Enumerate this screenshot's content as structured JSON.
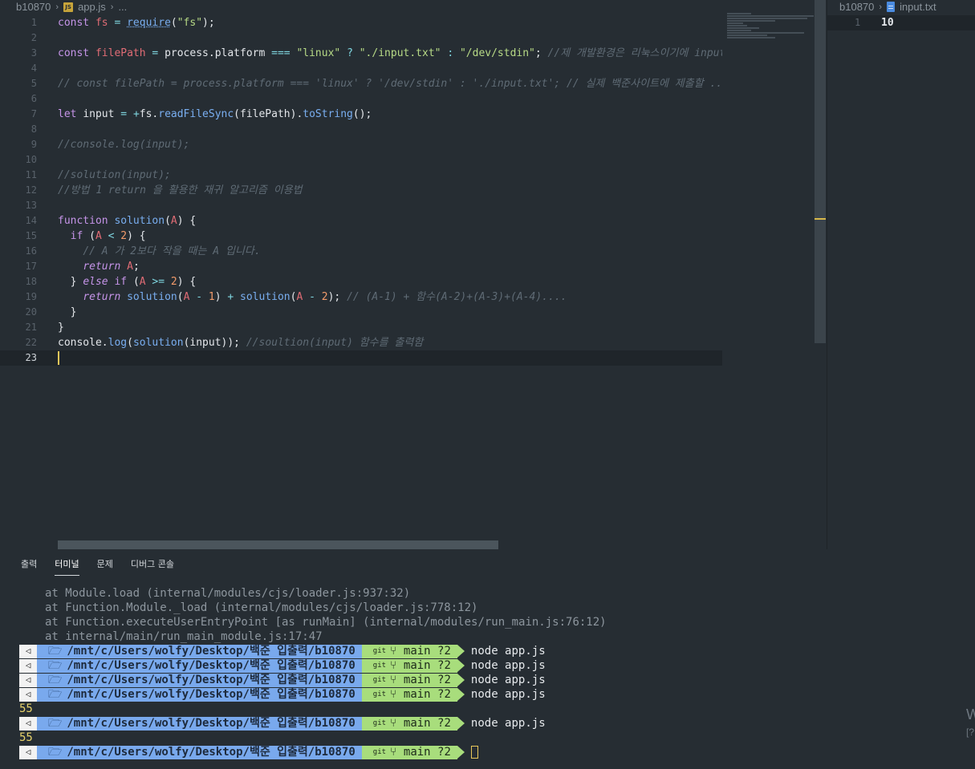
{
  "editor": {
    "breadcrumb": {
      "folder": "b10870",
      "file": "app.js",
      "more": "..."
    },
    "active_line": 23,
    "lines": [
      {
        "n": 1
      },
      {
        "n": 2
      },
      {
        "n": 3
      },
      {
        "n": 4
      },
      {
        "n": 5
      },
      {
        "n": 6
      },
      {
        "n": 7
      },
      {
        "n": 8
      },
      {
        "n": 9
      },
      {
        "n": 10
      },
      {
        "n": 11
      },
      {
        "n": 12
      },
      {
        "n": 13
      },
      {
        "n": 14
      },
      {
        "n": 15
      },
      {
        "n": 16
      },
      {
        "n": 17
      },
      {
        "n": 18
      },
      {
        "n": 19
      },
      {
        "n": 20
      },
      {
        "n": 21
      },
      {
        "n": 22
      },
      {
        "n": 23
      }
    ],
    "tokens": {
      "l1": [
        "const",
        "fs",
        "=",
        "require",
        "(",
        "\"fs\"",
        ");"
      ],
      "l3": [
        "const",
        "filePath",
        "=",
        "process.platform",
        "===",
        "\"linux\"",
        "?",
        "\"./input.txt\"",
        ":",
        "\"/dev/stdin\"",
        ";",
        "//제 개발환경은 리눅스이기에 input"
      ],
      "l5": "// const filePath = process.platform === 'linux' ? '/dev/stdin' : './input.txt'; // 실제 백준사이트에 제출할 ...",
      "l7": [
        "let",
        "input",
        "=",
        "+",
        "fs",
        ".",
        "readFileSync",
        "(filePath).",
        "toString",
        "();"
      ],
      "l9": "//console.log(input);",
      "l11": "//solution(input);",
      "l12": "//방법 1 return 을 활용한 재귀 알고리즘 이용법",
      "l14": [
        "function",
        "solution",
        "(",
        "A",
        ") {"
      ],
      "l15": [
        "if",
        "(",
        "A",
        "<",
        "2",
        ") {"
      ],
      "l16": "// A 가 2보다 작을 때는 A 입니다.",
      "l17": [
        "return",
        "A",
        ";"
      ],
      "l18": [
        "} ",
        "else",
        "if",
        "(",
        "A",
        ">=",
        "2",
        ") {"
      ],
      "l19": [
        "return",
        "solution",
        "(",
        "A",
        "-",
        "1",
        ")",
        "+",
        "solution",
        "(",
        "A",
        "-",
        "2",
        ");",
        "// (A-1) + 함수(A-2)+(A-3)+(A-4)...."
      ],
      "l20": "}",
      "l21": "}",
      "l22": [
        "console",
        ".",
        "log",
        "(",
        "solution",
        "(input));",
        "//soultion(input) 함수를 출력함"
      ]
    }
  },
  "right_pane": {
    "breadcrumb": {
      "folder": "b10870",
      "file": "input.txt"
    },
    "line_number": "1",
    "content": "10"
  },
  "panel": {
    "tabs": [
      {
        "label": "출력",
        "active": false
      },
      {
        "label": "터미널",
        "active": true
      },
      {
        "label": "문제",
        "active": false
      },
      {
        "label": "디버그 콘솔",
        "active": false
      }
    ],
    "error_lines": [
      "at Module.load (internal/modules/cjs/loader.js:937:32)",
      "at Function.Module._load (internal/modules/cjs/loader.js:778:12)",
      "at Function.executeUserEntryPoint [as runMain] (internal/modules/run_main.js:76:12)",
      "at internal/main/run_main_module.js:17:47"
    ],
    "prompt": {
      "path": "/mnt/c/Users/wolfy/Desktop/백준 입출력/b10870",
      "git_label": "git",
      "branch": "main ?2"
    },
    "entries": [
      {
        "type": "prompt",
        "cmd": "node app.js"
      },
      {
        "type": "prompt",
        "cmd": "node app.js"
      },
      {
        "type": "prompt",
        "cmd": "node app.js"
      },
      {
        "type": "prompt",
        "cmd": "node app.js"
      },
      {
        "type": "output",
        "text": "55"
      },
      {
        "type": "prompt",
        "cmd": "node app.js"
      },
      {
        "type": "output",
        "text": "55"
      },
      {
        "type": "prompt",
        "cmd": ""
      }
    ]
  },
  "edge_text": {
    "l1": "W",
    "l2": "[?"
  },
  "colors": {
    "background": "#262d33",
    "keyword": "#c594e8",
    "function": "#79aef0",
    "string": "#b7da86",
    "number": "#f39c6b",
    "comment": "#5f6b75",
    "prompt_path_bg": "#79a9ed",
    "prompt_git_bg": "#a8dd7c",
    "output": "#e8d36a"
  }
}
